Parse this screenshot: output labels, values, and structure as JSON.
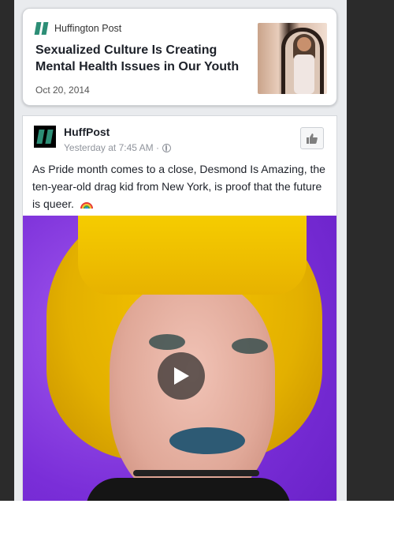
{
  "article": {
    "source": "Huffington Post",
    "title": "Sexualized Culture Is Creating Mental Health Issues in Our Youth",
    "date": "Oct 20, 2014"
  },
  "post": {
    "page_name": "HuffPost",
    "timestamp": "Yesterday at 7:45 AM ·",
    "text": "As Pride month comes to a close, Desmond Is Amazing, the ten-year-old drag kid from New York, is proof that the future is queer."
  },
  "icons": {
    "source_logo": "huffpost-logo-icon",
    "privacy": "globe-icon",
    "like_page": "thumbs-up-icon",
    "emoji": "rainbow-icon",
    "play": "play-icon"
  },
  "colors": {
    "brand": "#2d8e76",
    "video_bg": "#8a3ee6",
    "hair": "#f5c400"
  }
}
